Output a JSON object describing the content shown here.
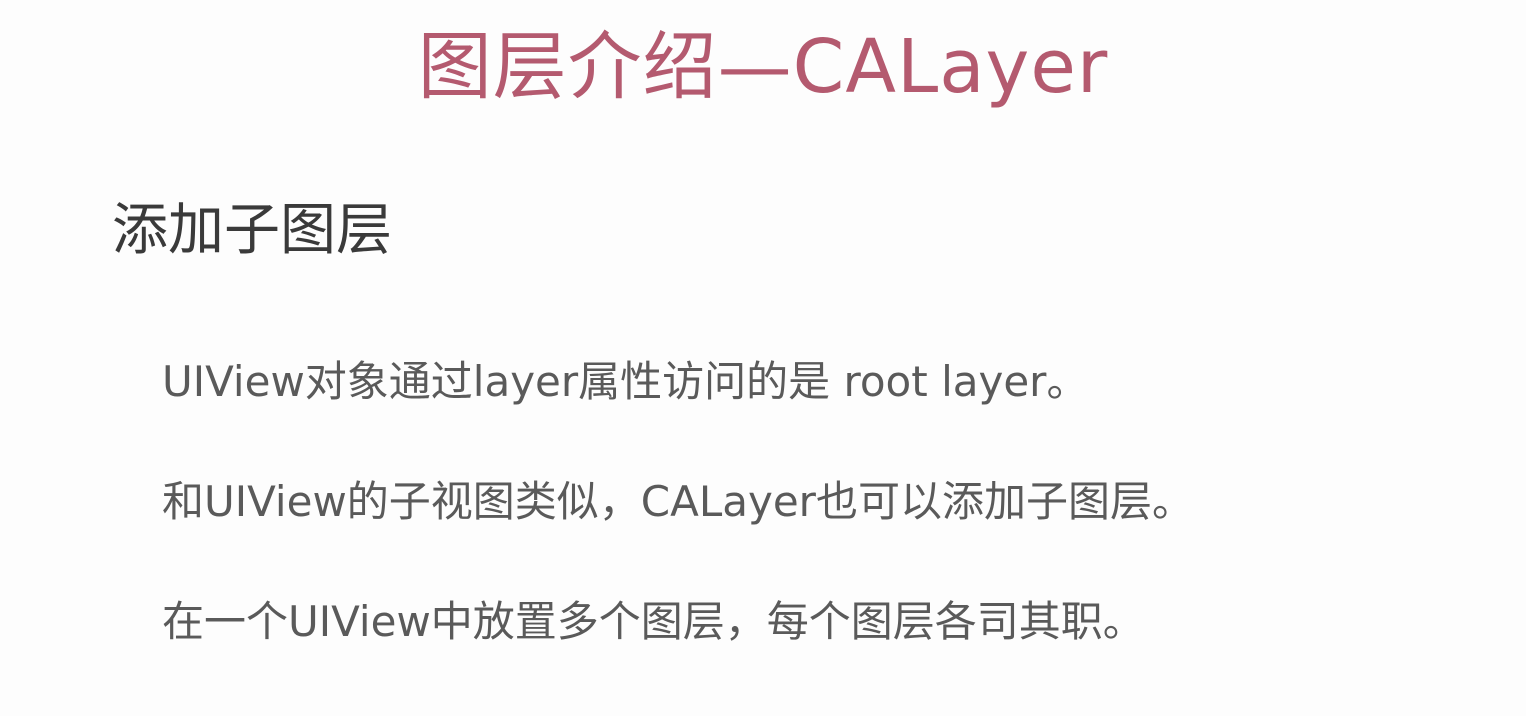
{
  "slide": {
    "title": "图层介绍—CALayer",
    "section_heading": "添加子图层",
    "bullets": [
      "UIView对象通过layer属性访问的是 root layer。",
      "和UIView的子视图类似，CALayer也可以添加子图层。",
      "在一个UIView中放置多个图层，每个图层各司其职。"
    ]
  },
  "colors": {
    "title": "#b45a6f",
    "heading": "#3a3a3a",
    "body": "#5a5a5a",
    "background": "#fdfdfd"
  }
}
